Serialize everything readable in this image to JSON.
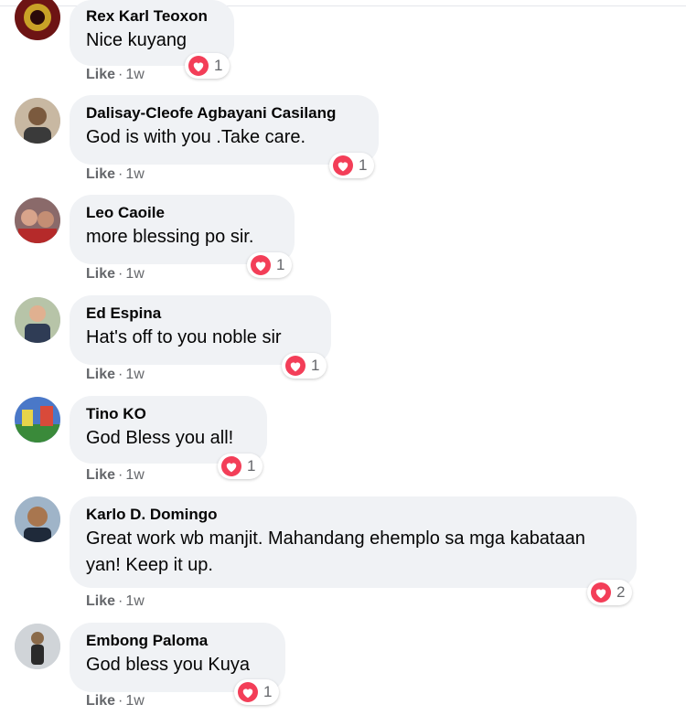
{
  "comments": [
    {
      "name": "Rex Karl Teoxon",
      "text": "Nice kuyang",
      "like": "Like",
      "sep": "·",
      "time": "1w",
      "reactions": "1"
    },
    {
      "name": "Dalisay-Cleofe Agbayani Casilang",
      "text": "God is with you .Take care.",
      "like": "Like",
      "sep": "·",
      "time": "1w",
      "reactions": "1"
    },
    {
      "name": "Leo Caoile",
      "text": "more blessing po sir.",
      "like": "Like",
      "sep": "·",
      "time": "1w",
      "reactions": "1"
    },
    {
      "name": "Ed Espina",
      "text": "Hat's off to you noble sir",
      "like": "Like",
      "sep": "·",
      "time": "1w",
      "reactions": "1"
    },
    {
      "name": "Tino KO",
      "text": "God Bless you all!",
      "like": "Like",
      "sep": "·",
      "time": "1w",
      "reactions": "1"
    },
    {
      "name": "Karlo D. Domingo",
      "text": "Great work wb manjit. Mahandang ehemplo sa mga kabataan yan! Keep it up.",
      "like": "Like",
      "sep": "·",
      "time": "1w",
      "reactions": "2"
    },
    {
      "name": "Embong Paloma",
      "text": "God bless you Kuya",
      "like": "Like",
      "sep": "·",
      "time": "1w",
      "reactions": "1"
    }
  ],
  "colors": {
    "bubble": "#f0f2f5",
    "heart": "#f33e58",
    "meta": "#65676b"
  },
  "reaction_icon": "heart-icon"
}
